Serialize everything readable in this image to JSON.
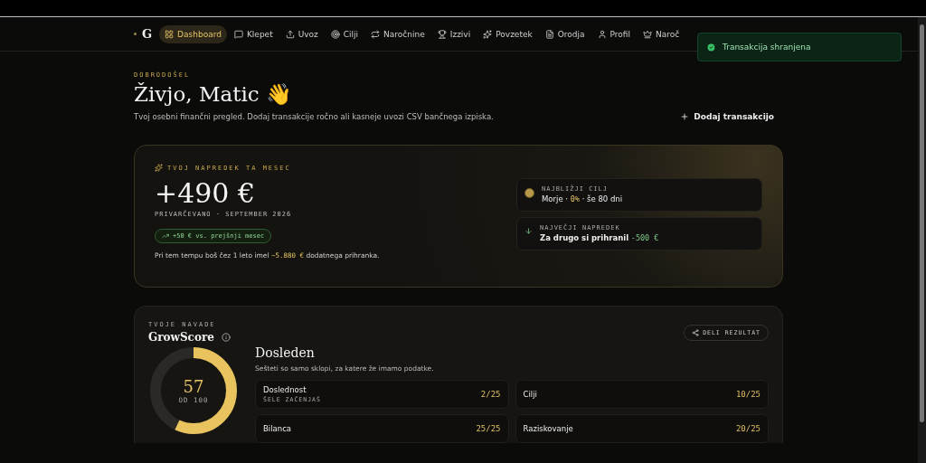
{
  "nav": {
    "logo": "G",
    "items": [
      {
        "label": "Dashboard",
        "selected": true
      },
      {
        "label": "Klepet",
        "selected": false
      },
      {
        "label": "Uvoz",
        "selected": false
      },
      {
        "label": "Cilji",
        "selected": false
      },
      {
        "label": "Naročnine",
        "selected": false
      },
      {
        "label": "Izzivi",
        "selected": false
      },
      {
        "label": "Povzetek",
        "selected": false
      },
      {
        "label": "Orodja",
        "selected": false
      },
      {
        "label": "Profil",
        "selected": false
      },
      {
        "label": "Naroč",
        "selected": false
      }
    ]
  },
  "toast": {
    "text": "Transakcija shranjena"
  },
  "welcome": {
    "eyebrow": "DOBRODOŠEL",
    "title": "Živjo, Matic 👋",
    "subtitle": "Tvoj osebni finančni pregled. Dodaj transakcije ročno ali kasneje uvozi CSV bančnega izpiska.",
    "add_button": "Dodaj transakcijo"
  },
  "progress": {
    "eyebrow": "TVOJ NAPREDEK TA MESEC",
    "amount": "+490 €",
    "period": "PRIVARČEVANO · SEPTEMBER 2026",
    "trend": "+50 € vs. prejšnji mesec",
    "projection": "Pri tem tempu boš čez 1 leto imel **~5.880 €** dodatnega prihranka.",
    "cards": [
      {
        "kind": "goal",
        "label": "NAJBLIŽJI CILJ",
        "summary": "Morje · **0%** · še 80 dni"
      },
      {
        "kind": "gain",
        "label": "NAJVEČJI NAPREDEK",
        "name": "Za drugo si prihranil",
        "amount": "-500 €"
      }
    ]
  },
  "growscore": {
    "eyebrow": "TVOJE NAVADE",
    "title": "GrowScore",
    "share": "DELI REZULTAT",
    "score": "57",
    "score_of": "OD 100",
    "level": 0.57,
    "tier": "Dosleden",
    "note": "Sešteti so samo sklopi, za katere že imamo podatke.",
    "metrics": [
      {
        "name": "Doslednost",
        "hint": "ŠELE ZAČENJAŠ",
        "value": "2/25"
      },
      {
        "name": "Cilji",
        "value": "10/25"
      },
      {
        "name": "Bilanca",
        "value": "25/25"
      },
      {
        "name": "Raziskovanje",
        "value": "20/25"
      }
    ]
  }
}
